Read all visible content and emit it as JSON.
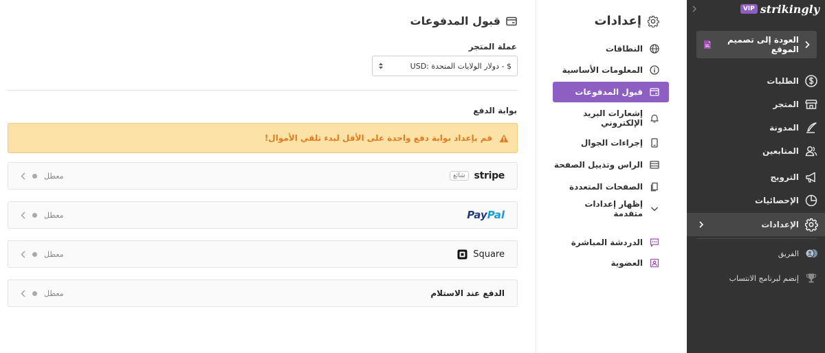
{
  "sidebar": {
    "brand": {
      "vip": "VIP",
      "name": "strikingly"
    },
    "back_label": "العودة إلى تصميم الموقع",
    "items": [
      {
        "label": "الطلبات",
        "icon": "dollar-circle-icon"
      },
      {
        "label": "المتجر",
        "icon": "store-icon"
      },
      {
        "label": "المدونة",
        "icon": "quill-pen-icon"
      },
      {
        "label": "المتابعين",
        "icon": "users-icon"
      },
      {
        "label": "الترويج",
        "icon": "megaphone-icon"
      },
      {
        "label": "الإحصائيات",
        "icon": "pie-chart-icon"
      },
      {
        "label": "الإعدادات",
        "icon": "gear-icon"
      }
    ],
    "extra": [
      {
        "label": "الفريق",
        "icon": "team-avatars-icon"
      },
      {
        "label": "إنضم لبرنامج الانتساب",
        "icon": "trophy-icon"
      }
    ]
  },
  "settings_nav": {
    "title": "إعدادات",
    "items": [
      {
        "label": "النطاقات"
      },
      {
        "label": "المعلومات الأساسية"
      },
      {
        "label": "قبول المدفوعات"
      },
      {
        "label": "إشعارات البريد الإلكتروني"
      },
      {
        "label": "إجراءات الجوال"
      },
      {
        "label": "الراس وتذييل الصفحة"
      },
      {
        "label": "الصفحات المتعددة"
      },
      {
        "label": "إظهار إعدادات متقدمة"
      },
      {
        "label": "الدردشة المباشرة"
      },
      {
        "label": "العضوية"
      }
    ]
  },
  "main": {
    "title": "قبول المدفوعات",
    "currency_label": "عملة المتجر",
    "currency_value": "USD: دولار الولايات المتحدة - $",
    "gateway_label": "بوابة الدفع",
    "alert": "قم بإعداد بوابة دفع واحدة على الأقل لبدء تلقي الأموال!",
    "gateways": [
      {
        "name": "stripe",
        "badge": "شائع",
        "status": "معطل"
      },
      {
        "name_part1": "Pay",
        "name_part2": "Pal",
        "status": "معطل"
      },
      {
        "name": "Square",
        "status": "معطل"
      },
      {
        "name": "الدفع عند الاستلام",
        "status": "معطل"
      }
    ]
  },
  "colors": {
    "sidebar_bg": "#333333",
    "accent_purple": "#8e5fc3",
    "alert_bg": "#fde2a8",
    "alert_text": "#e07a1f"
  }
}
